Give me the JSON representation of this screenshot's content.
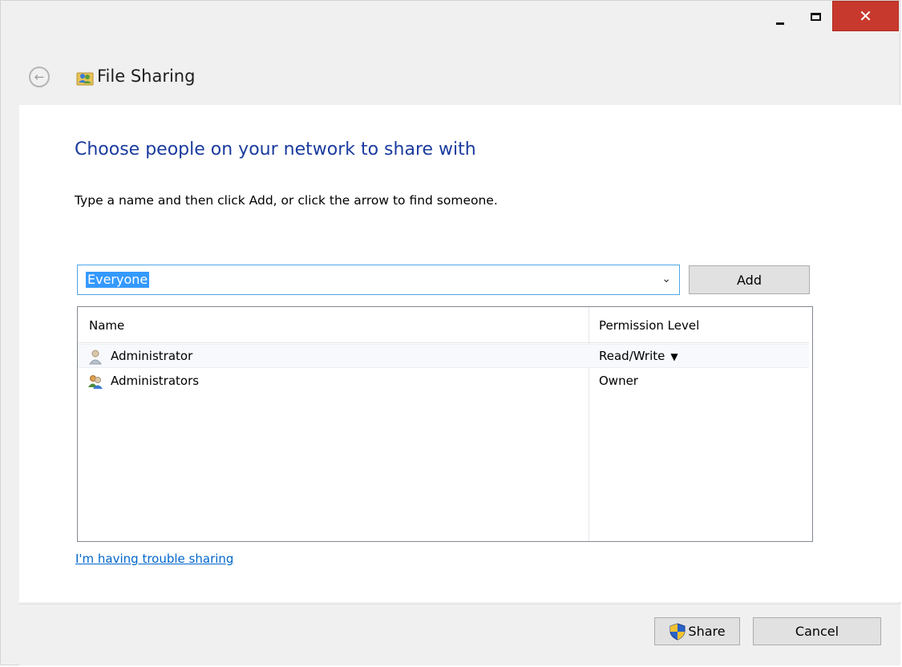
{
  "window": {
    "title": "File Sharing",
    "close_glyph": "✕"
  },
  "nav": {
    "back_icon": "back-arrow-icon",
    "title_icon": "people-sharing-icon"
  },
  "main": {
    "heading": "Choose people on your network to share with",
    "instruction": "Type a name and then click Add, or click the arrow to find someone.",
    "combo": {
      "value": "Everyone",
      "arrow_glyph": "⌄"
    },
    "add_label": "Add",
    "table": {
      "columns": [
        "Name",
        "Permission Level"
      ],
      "rows": [
        {
          "name": "Administrator",
          "permission": "Read/Write",
          "icon": "user-icon",
          "has_dropdown": true,
          "selected": true
        },
        {
          "name": "Administrators",
          "permission": "Owner",
          "icon": "user-group-icon",
          "has_dropdown": false,
          "selected": false
        }
      ]
    },
    "trouble_link": "I'm having trouble sharing"
  },
  "footer": {
    "share_label": "Share",
    "cancel_label": "Cancel"
  },
  "colors": {
    "heading": "#1a3b9e",
    "link": "#0066cc",
    "close_button": "#c7392c",
    "selection": "#3399ff"
  }
}
